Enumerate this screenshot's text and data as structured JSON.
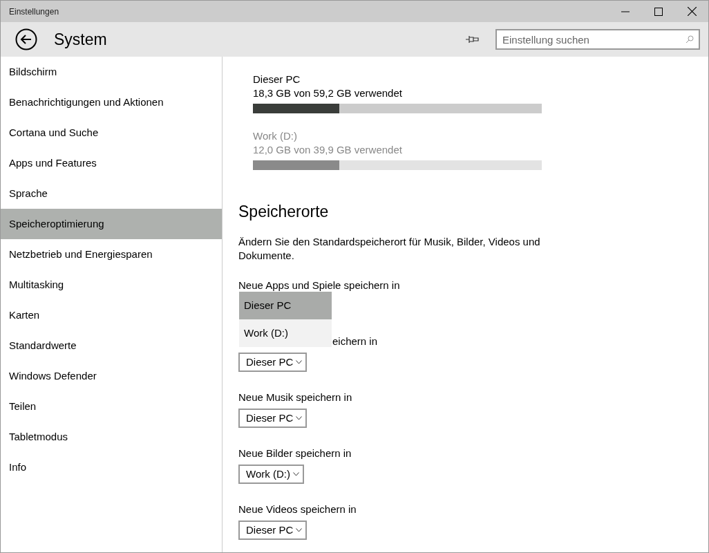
{
  "window": {
    "title": "Einstellungen"
  },
  "header": {
    "title": "System",
    "search": {
      "placeholder": "Einstellung suchen"
    }
  },
  "sidebar": {
    "items": [
      {
        "label": "Bildschirm",
        "selected": false
      },
      {
        "label": "Benachrichtigungen und Aktionen",
        "selected": false
      },
      {
        "label": "Cortana und Suche",
        "selected": false
      },
      {
        "label": "Apps und Features",
        "selected": false
      },
      {
        "label": "Sprache",
        "selected": false
      },
      {
        "label": "Speicheroptimierung",
        "selected": true
      },
      {
        "label": "Netzbetrieb und Energiesparen",
        "selected": false
      },
      {
        "label": "Multitasking",
        "selected": false
      },
      {
        "label": "Karten",
        "selected": false
      },
      {
        "label": "Standardwerte",
        "selected": false
      },
      {
        "label": "Windows Defender",
        "selected": false
      },
      {
        "label": "Teilen",
        "selected": false
      },
      {
        "label": "Tabletmodus",
        "selected": false
      },
      {
        "label": "Info",
        "selected": false
      }
    ]
  },
  "drives": [
    {
      "name": "Dieser PC",
      "usage": "18,3 GB von 59,2 GB verwendet",
      "level": 0.3,
      "active": true
    },
    {
      "name": "Work (D:)",
      "usage": "12,0 GB von 39,9 GB verwendet",
      "level": 0.3,
      "active": false
    }
  ],
  "section": {
    "title": "Speicherorte",
    "description": "Ändern Sie den Standardspeicherort für Musik, Bilder, Videos und Dokumente."
  },
  "locations": [
    {
      "label": "Neue Apps und Spiele speichern in",
      "options": [
        {
          "label": "Dieser PC",
          "selected": true
        },
        {
          "label": "Work (D:)",
          "selected": false
        }
      ]
    },
    {
      "label": "eichern in",
      "value": "Dieser PC"
    },
    {
      "label": "Neue Musik speichern in",
      "value": "Dieser PC"
    },
    {
      "label": "Neue Bilder speichern in",
      "value": "Work (D:)"
    },
    {
      "label": "Neue Videos speichern in",
      "value": "Dieser PC"
    }
  ]
}
